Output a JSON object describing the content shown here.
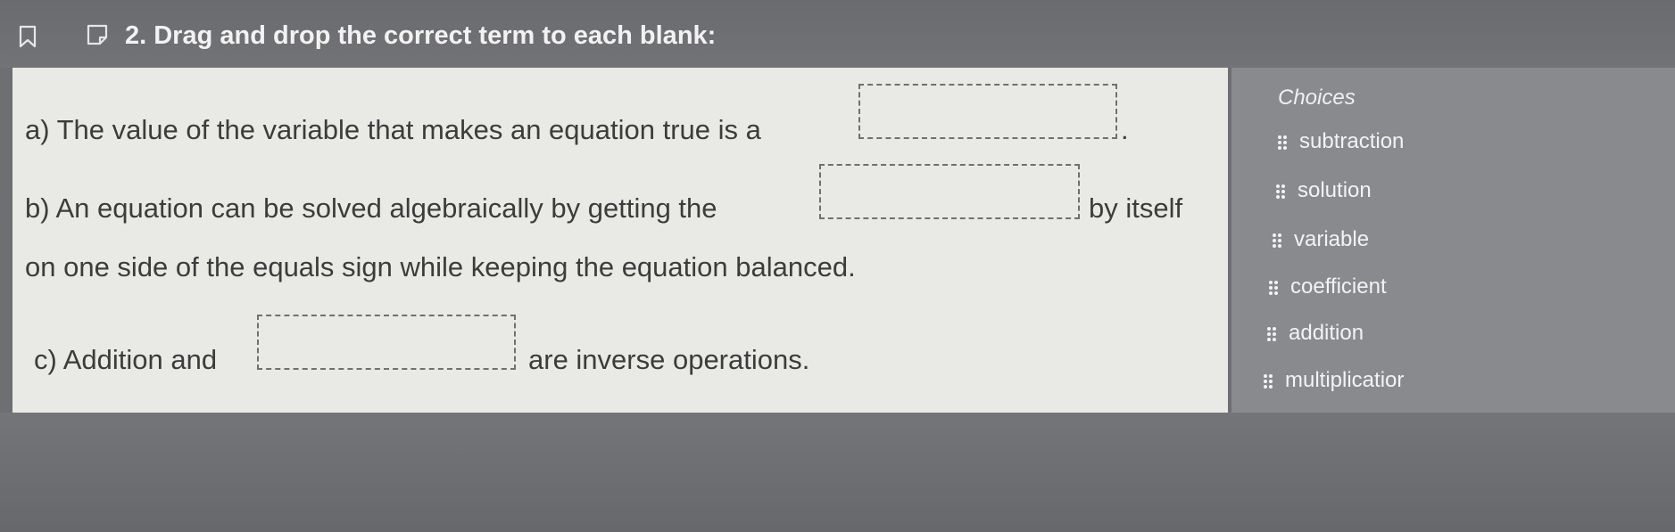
{
  "question": {
    "title": "2. Drag and drop the correct term to each blank:"
  },
  "content": {
    "a_text": "a) The value of the variable that makes an equation true is a",
    "a_after": ".",
    "b_text": "b) An equation can be solved algebraically by getting the",
    "b_after": "by itself",
    "b_continued": "on one side of the equals sign while keeping the equation balanced.",
    "c_text": "c) Addition and",
    "c_after": "are inverse operations."
  },
  "choices": {
    "title": "Choices",
    "items": [
      {
        "label": "subtraction"
      },
      {
        "label": "solution"
      },
      {
        "label": "variable"
      },
      {
        "label": "coefficient"
      },
      {
        "label": "addition"
      },
      {
        "label": "multiplicatior"
      }
    ]
  },
  "icons": {
    "bookmark": "bookmark-icon",
    "flag": "flag-icon",
    "grip": "drag-grip-icon"
  },
  "colors": {
    "header_bg": "#6a6b6e",
    "panel_bg": "#e9e9e5",
    "choices_bg": "#888a8d",
    "text_dark": "#3c3c3c",
    "text_light": "#f3f3f3"
  }
}
